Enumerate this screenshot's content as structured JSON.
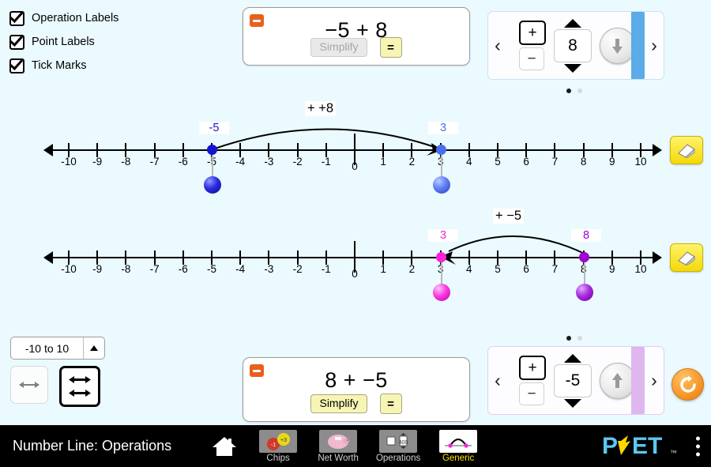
{
  "checkboxes": [
    {
      "label": "Operation Labels",
      "checked": true
    },
    {
      "label": "Point Labels",
      "checked": true
    },
    {
      "label": "Tick Marks",
      "checked": true
    }
  ],
  "top_equation": {
    "expression": "−5 + 8",
    "simplify_label": "Simplify",
    "simplify_enabled": false,
    "equals_label": "=",
    "collapse_icon": "minus-icon"
  },
  "bottom_equation": {
    "expression": "8 + −5",
    "simplify_label": "Simplify",
    "simplify_enabled": true,
    "equals_label": "=",
    "collapse_icon": "minus-icon"
  },
  "top_carousel": {
    "plus_label": "+",
    "minus_label": "−",
    "selected_sign": "plus",
    "spinner_value": "8",
    "direction_icon": "arrow-hook-down-icon",
    "prev_label": "‹",
    "next_label": "›",
    "edge_color": "#5aabe8",
    "page_dots": 2,
    "active_dot": 0
  },
  "bottom_carousel": {
    "plus_label": "+",
    "minus_label": "−",
    "selected_sign": "plus",
    "spinner_value": "-5",
    "direction_icon": "arrow-hook-up-icon",
    "prev_label": "‹",
    "next_label": "›",
    "edge_color": "#ddb7ee",
    "page_dots": 2,
    "active_dot": 0
  },
  "number_lines": [
    {
      "id": "number-line-1",
      "ticks": [
        "-10",
        "-9",
        "-8",
        "-7",
        "-6",
        "-5",
        "-4",
        "-3",
        "-2",
        "-1",
        "0",
        "1",
        "2",
        "3",
        "4",
        "5",
        "6",
        "7",
        "8",
        "9",
        "10"
      ],
      "range_min": -10,
      "range_max": 10,
      "operation_label": "+ +8",
      "start_point": {
        "value": -5,
        "label": "-5",
        "color": "#1414d0"
      },
      "end_point": {
        "value": 3,
        "label": "3",
        "color": "#4a6ef0"
      },
      "arc_direction": "right",
      "erase_icon": "eraser-icon"
    },
    {
      "id": "number-line-2",
      "ticks": [
        "-10",
        "-9",
        "-8",
        "-7",
        "-6",
        "-5",
        "-4",
        "-3",
        "-2",
        "-1",
        "0",
        "1",
        "2",
        "3",
        "4",
        "5",
        "6",
        "7",
        "8",
        "9",
        "10"
      ],
      "range_min": -10,
      "range_max": 10,
      "operation_label": "+ −5",
      "start_point": {
        "value": 8,
        "label": "8",
        "color": "#a000d0"
      },
      "end_point": {
        "value": 3,
        "label": "3",
        "color": "#fc22d8"
      },
      "arc_direction": "left",
      "erase_icon": "eraser-icon"
    }
  ],
  "range_selector": {
    "value": "-10 to 10",
    "chevron": "chevron-up-icon"
  },
  "line_count_radios": [
    {
      "name": "single-line",
      "selected": false
    },
    {
      "name": "double-line",
      "selected": true
    }
  ],
  "reset_all": {
    "icon": "reset-icon"
  },
  "navbar": {
    "title": "Number Line: Operations",
    "home_icon": "home-icon",
    "tabs": [
      {
        "label": "Chips",
        "icon": "chips-icon",
        "active": false
      },
      {
        "label": "Net Worth",
        "icon": "piggy-bank-icon",
        "active": false
      },
      {
        "label": "Operations",
        "icon": "operations-icon",
        "active": false
      },
      {
        "label": "Generic",
        "icon": "generic-arc-icon",
        "active": true
      }
    ],
    "logo": "PhET",
    "menu_icon": "kebab-menu-icon"
  },
  "colors": {
    "background": "#eafaff",
    "accent_orange": "#e8601c",
    "yellow": "#f7f5b3",
    "navbar": "#000000",
    "logo_blue": "#5cc8f0",
    "logo_yellow": "#ffd800"
  }
}
